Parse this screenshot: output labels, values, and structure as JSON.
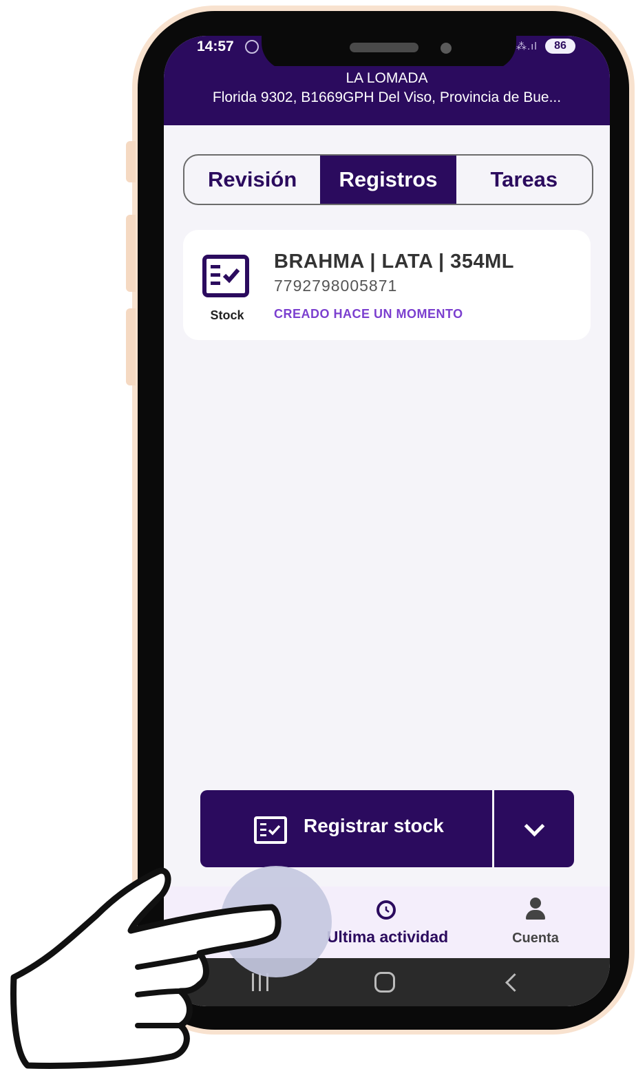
{
  "status_bar": {
    "time": "14:57",
    "signal": "⁂.ıl",
    "battery": "86"
  },
  "header": {
    "store_name": "LA LOMADA",
    "store_address": "Florida 9302, B1669GPH Del Viso, Provincia de Bue..."
  },
  "tabs": [
    {
      "label": "Revisión",
      "active": false
    },
    {
      "label": "Registros",
      "active": true
    },
    {
      "label": "Tareas",
      "active": false
    }
  ],
  "record_card": {
    "icon": "checklist-icon",
    "type_label": "Stock",
    "title": "BRAHMA | LATA | 354ML",
    "barcode": "7792798005871",
    "status": "CREADO HACE UN MOMENTO"
  },
  "action_button": {
    "icon": "checklist-icon",
    "label": "Registrar stock",
    "dropdown_icon": "chevron-down-icon"
  },
  "bottom_nav": {
    "items": [
      {
        "label": "Ultima actividad",
        "icon": "history-icon"
      },
      {
        "label": "Cuenta",
        "icon": "person-icon"
      }
    ]
  },
  "colors": {
    "primary": "#2b0b5e",
    "accent": "#7b3fcf",
    "shell": "#f8e2cf"
  }
}
